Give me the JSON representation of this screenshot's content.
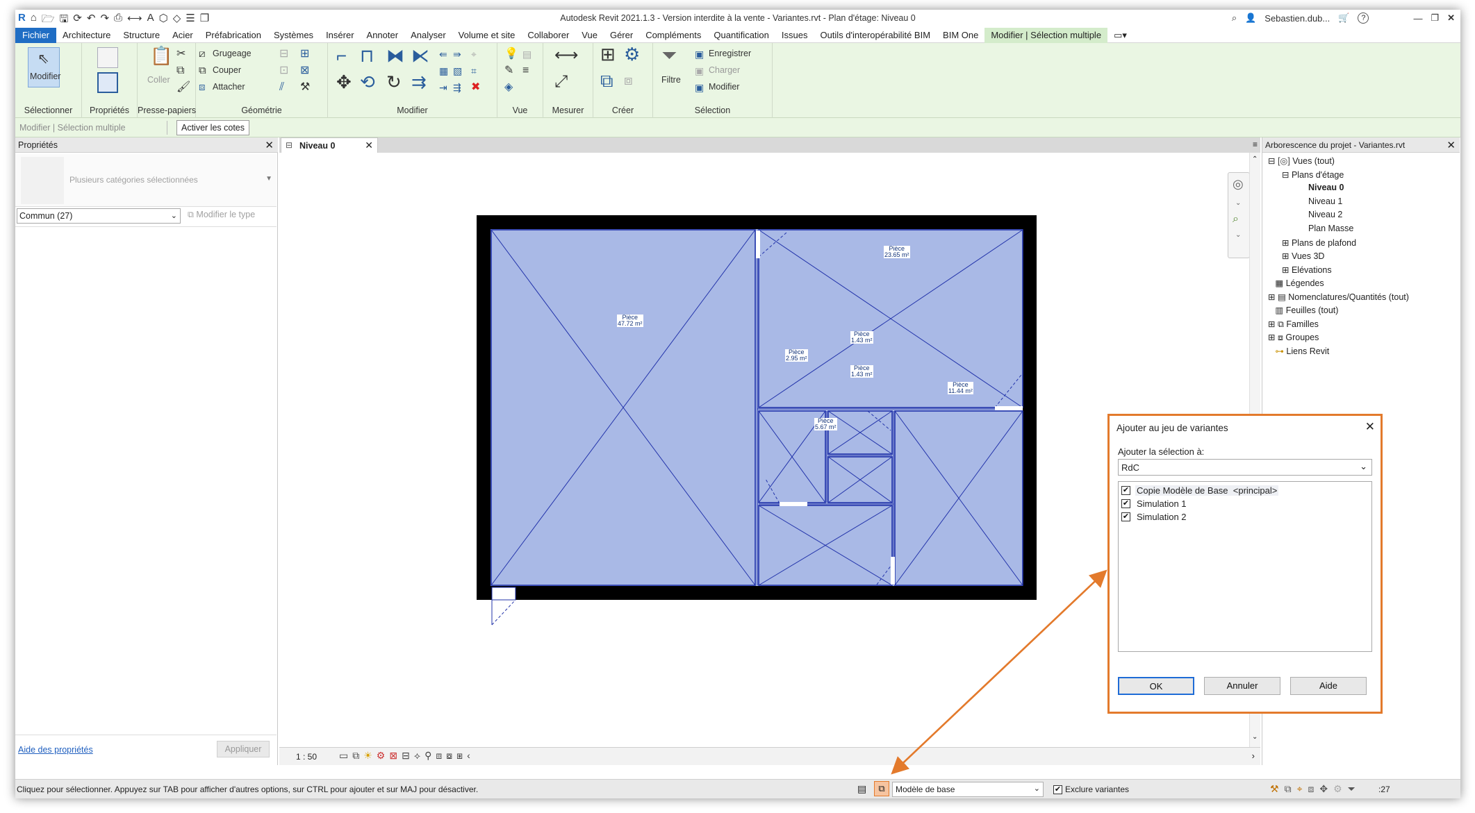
{
  "titlebar": {
    "title": "Autodesk Revit 2021.1.3 - Version interdite à la vente - Variantes.rvt - Plan d'étage: Niveau 0",
    "user": "Sebastien.dub...",
    "help_icon": "?"
  },
  "menu": {
    "tabs": [
      "Fichier",
      "Architecture",
      "Structure",
      "Acier",
      "Préfabrication",
      "Systèmes",
      "Insérer",
      "Annoter",
      "Analyser",
      "Volume et site",
      "Collaborer",
      "Vue",
      "Gérer",
      "Compléments",
      "Quantification",
      "Issues",
      "Outils d'interopérabilité BIM",
      "BIM One",
      "Modifier | Sélection multiple"
    ]
  },
  "ribbon": {
    "modify_label": "Modifier",
    "coller_label": "Coller",
    "groups": [
      "Sélectionner",
      "Propriétés",
      "Presse-papiers",
      "Géométrie",
      "Modifier",
      "Vue",
      "Mesurer",
      "Créer",
      "Sélection"
    ],
    "geometry_items": [
      "Grugeage",
      "Couper",
      "Attacher"
    ],
    "filtre_label": "Filtre",
    "selection_items": [
      "Enregistrer",
      "Charger",
      "Modifier"
    ]
  },
  "optionbar": {
    "context": "Modifier | Sélection multiple",
    "button": "Activer les cotes"
  },
  "properties": {
    "title": "Propriétés",
    "type_selector": "Plusieurs catégories sélectionnées",
    "filter_value": "Commun (27)",
    "edit_type": "Modifier le type",
    "help_link": "Aide des propriétés",
    "apply": "Appliquer"
  },
  "view": {
    "tab": "Niveau 0",
    "scale": "1 : 50",
    "rooms": [
      {
        "name": "Pièce",
        "area": "47.72 m²"
      },
      {
        "name": "Pièce",
        "area": "23.65 m²"
      },
      {
        "name": "Pièce",
        "area": "1.43 m²"
      },
      {
        "name": "Pièce",
        "area": "2.95 m²"
      },
      {
        "name": "Pièce",
        "area": "1.43 m²"
      },
      {
        "name": "Pièce",
        "area": "11.44 m²"
      },
      {
        "name": "Pièce",
        "area": "5.67 m²"
      }
    ]
  },
  "browser": {
    "title": "Arborescence du projet - Variantes.rvt",
    "nodes": [
      "Vues (tout)",
      "Plans d'étage",
      "Niveau 0",
      "Niveau 1",
      "Niveau 2",
      "Plan Masse",
      "Plans de plafond",
      "Vues 3D",
      "Elévations",
      "Légendes",
      "Nomenclatures/Quantités (tout)",
      "Feuilles (tout)",
      "Familles",
      "Groupes",
      "Liens Revit"
    ]
  },
  "dialog": {
    "title": "Ajouter au jeu de variantes",
    "label": "Ajouter la sélection à:",
    "select_value": "RdC",
    "options": [
      {
        "label": "Copie Modèle de Base",
        "tag": "<principal>",
        "checked": true
      },
      {
        "label": "Simulation 1",
        "checked": true
      },
      {
        "label": "Simulation 2",
        "checked": true
      }
    ],
    "ok": "OK",
    "cancel": "Annuler",
    "help": "Aide"
  },
  "statusbar": {
    "message": "Cliquez pour sélectionner. Appuyez sur TAB pour afficher d'autres options, sur CTRL pour ajouter et sur MAJ pour désactiver.",
    "design_option": "Modèle de base",
    "exclude_label": "Exclure variantes",
    "filter_count": ":27"
  },
  "colors": {
    "ribbon_bg": "#eaf6e3",
    "file_tab": "#1f6dc4",
    "room_fill": "#a9b9e6",
    "room_line": "#2233aa",
    "wall": "#000000",
    "callout": "#e37a2c"
  }
}
